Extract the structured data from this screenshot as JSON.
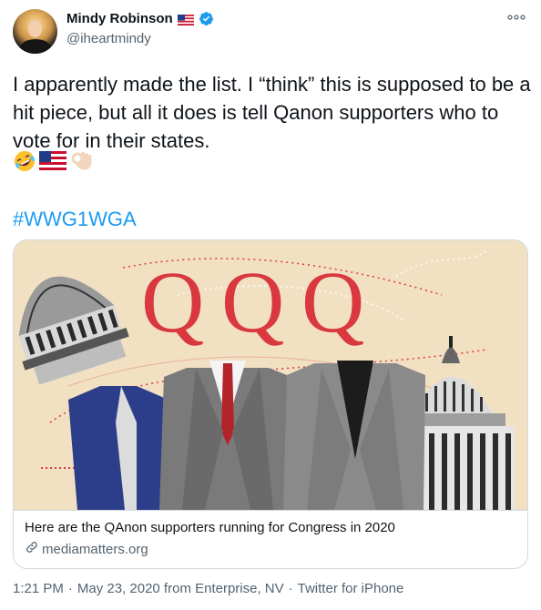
{
  "author": {
    "display_name": "Mindy Robinson",
    "handle": "@iheartmindy",
    "verified": true,
    "flag_icon": "us-flag-icon",
    "avatar_icon": "avatar"
  },
  "tweet": {
    "text": "I apparently made the list. I “think” this is supposed to be a hit piece, but all it does is tell Qanon supporters who to vote for in their states.",
    "emojis": [
      "rolling-on-floor-laughing-emoji",
      "us-flag-emoji",
      "ok-hand-emoji"
    ],
    "hashtag": "#WWG1WGA"
  },
  "card": {
    "title": "Here are the QAnon supporters running for Congress in 2020",
    "domain": "mediamatters.org",
    "image_letters": [
      "Q",
      "Q",
      "Q"
    ]
  },
  "meta": {
    "time": "1:21 PM",
    "separator": "·",
    "date": "May 23, 2020 from Enterprise, NV",
    "source": "Twitter for iPhone"
  },
  "colors": {
    "link": "#1d9bf0",
    "secondary_text": "#536471",
    "q_red": "#d9393e",
    "card_bg": "#f2e0c2"
  }
}
